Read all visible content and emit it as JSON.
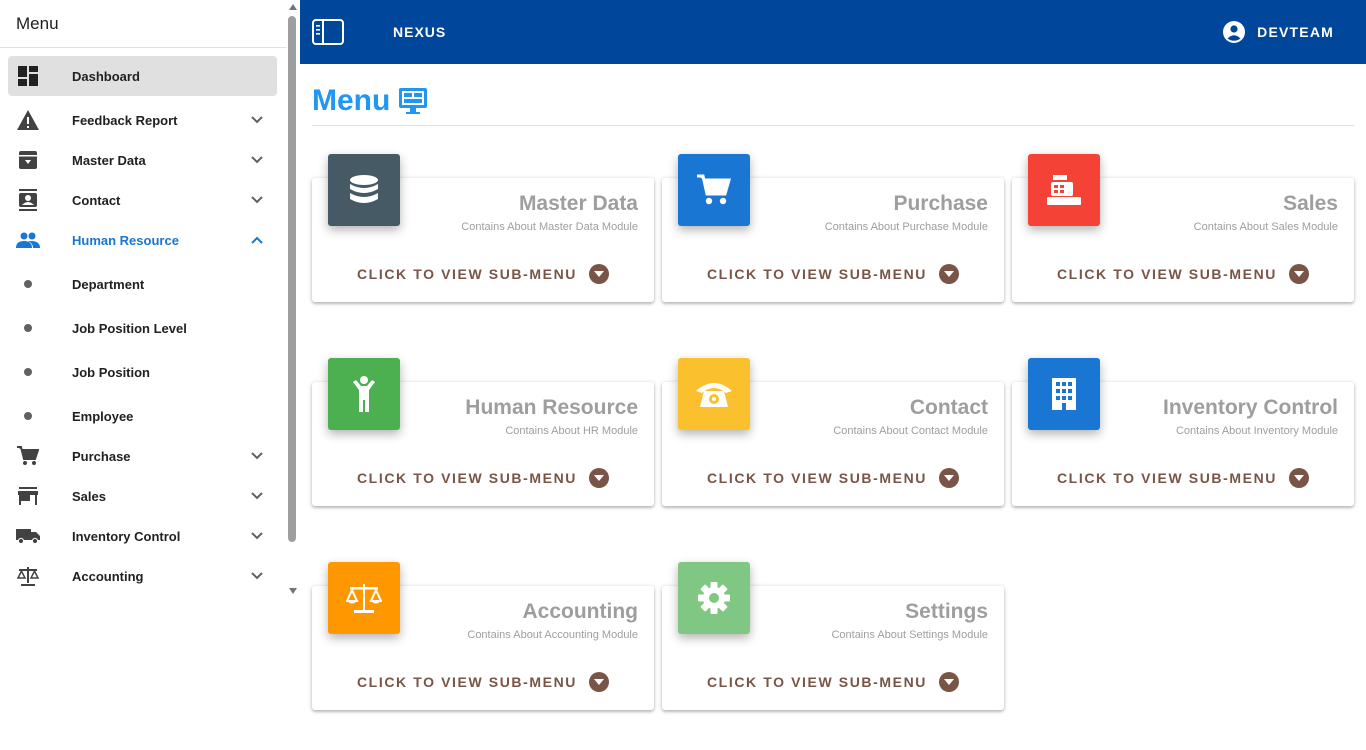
{
  "sidebar": {
    "title": "Menu",
    "items": [
      {
        "label": "Dashboard",
        "icon": "dashboard-icon"
      },
      {
        "label": "Feedback Report",
        "icon": "warning-icon"
      },
      {
        "label": "Master Data",
        "icon": "archive-icon"
      },
      {
        "label": "Contact",
        "icon": "contact-card-icon"
      },
      {
        "label": "Human Resource",
        "icon": "people-icon"
      },
      {
        "label": "Department"
      },
      {
        "label": "Job Position Level"
      },
      {
        "label": "Job Position"
      },
      {
        "label": "Employee"
      },
      {
        "label": "Purchase",
        "icon": "cart-icon"
      },
      {
        "label": "Sales",
        "icon": "store-icon"
      },
      {
        "label": "Inventory Control",
        "icon": "truck-icon"
      },
      {
        "label": "Accounting",
        "icon": "scale-icon"
      }
    ]
  },
  "header": {
    "app_name": "NEXUS",
    "user": "DEVTEAM"
  },
  "main": {
    "title": "Menu",
    "action_label": "CLICK TO VIEW SUB-MENU",
    "cards": [
      {
        "title": "Master Data",
        "subtitle": "Contains About Master Data Module",
        "color": "#455a64",
        "icon": "database-icon"
      },
      {
        "title": "Purchase",
        "subtitle": "Contains About Purchase Module",
        "color": "#1976d2",
        "icon": "cart-icon"
      },
      {
        "title": "Sales",
        "subtitle": "Contains About Sales Module",
        "color": "#f44336",
        "icon": "cash-register-icon"
      },
      {
        "title": "Human Resource",
        "subtitle": "Contains About HR Module",
        "color": "#4caf50",
        "icon": "person-icon"
      },
      {
        "title": "Contact",
        "subtitle": "Contains About Contact Module",
        "color": "#fbc02d",
        "icon": "phone-icon"
      },
      {
        "title": "Inventory Control",
        "subtitle": "Contains About Inventory Module",
        "color": "#1976d2",
        "icon": "building-icon"
      },
      {
        "title": "Accounting",
        "subtitle": "Contains About Accounting Module",
        "color": "#ff9800",
        "icon": "scale-icon"
      },
      {
        "title": "Settings",
        "subtitle": "Contains About Settings Module",
        "color": "#81c784",
        "icon": "gear-icon"
      }
    ]
  },
  "colors": {
    "topbar": "#00469b",
    "accent": "#2196f3",
    "action": "#795548"
  }
}
